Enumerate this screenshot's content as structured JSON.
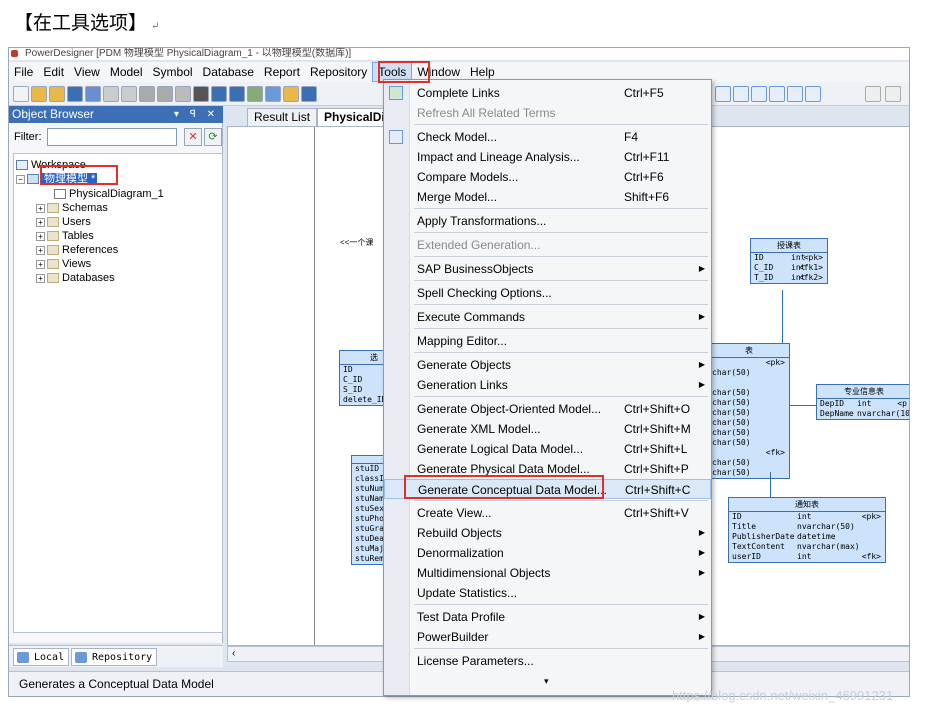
{
  "caption": "【在工具选项】",
  "caption_mark": "↵",
  "titlebar_text": "PowerDesigner [PDM 物理模型 PhysicalDiagram_1 - 以物理模型(数据库)]",
  "menubar": [
    "File",
    "Edit",
    "View",
    "Model",
    "Symbol",
    "Database",
    "Report",
    "Repository",
    "Tools",
    "Window",
    "Help"
  ],
  "active_menu": "Tools",
  "object_browser": {
    "title": "Object Browser",
    "controls": "▾ ꟼ ✕",
    "filter_label": "Filter:",
    "tree": {
      "workspace": "Workspace",
      "model": "物理模型 *",
      "diagram": "PhysicalDiagram_1",
      "folders": [
        "Schemas",
        "Users",
        "Tables",
        "References",
        "Views",
        "Databases"
      ]
    },
    "tabs": [
      "Local",
      "Repository"
    ]
  },
  "diagram_tabs": [
    "Result List",
    "PhysicalDia"
  ],
  "status": "Generates a Conceptual Data Model",
  "tools_menu": {
    "items": [
      {
        "label": "Complete Links",
        "shortcut": "Ctrl+F5",
        "icon": "links-icon"
      },
      {
        "label": "Refresh All Related Terms",
        "disabled": true
      },
      {
        "sep": true
      },
      {
        "label": "Check Model...",
        "shortcut": "F4",
        "icon": "check-model-icon"
      },
      {
        "label": "Impact and Lineage Analysis...",
        "shortcut": "Ctrl+F11"
      },
      {
        "label": "Compare Models...",
        "shortcut": "Ctrl+F6"
      },
      {
        "label": "Merge Model...",
        "shortcut": "Shift+F6"
      },
      {
        "sep": true
      },
      {
        "label": "Apply Transformations..."
      },
      {
        "sep": true
      },
      {
        "label": "Extended Generation...",
        "disabled": true
      },
      {
        "sep": true
      },
      {
        "label": "SAP BusinessObjects",
        "submenu": true
      },
      {
        "sep": true
      },
      {
        "label": "Spell Checking Options..."
      },
      {
        "sep": true
      },
      {
        "label": "Execute Commands",
        "submenu": true
      },
      {
        "sep": true
      },
      {
        "label": "Mapping Editor..."
      },
      {
        "sep": true
      },
      {
        "label": "Generate Objects",
        "submenu": true
      },
      {
        "label": "Generation Links",
        "submenu": true
      },
      {
        "sep": true
      },
      {
        "label": "Generate Object-Oriented Model...",
        "shortcut": "Ctrl+Shift+O"
      },
      {
        "label": "Generate XML Model...",
        "shortcut": "Ctrl+Shift+M"
      },
      {
        "label": "Generate Logical Data Model...",
        "shortcut": "Ctrl+Shift+L"
      },
      {
        "label": "Generate Physical Data Model...",
        "shortcut": "Ctrl+Shift+P"
      },
      {
        "label": "Generate Conceptual Data Model...",
        "shortcut": "Ctrl+Shift+C",
        "highlighted": true
      },
      {
        "sep": true
      },
      {
        "label": "Create View...",
        "shortcut": "Ctrl+Shift+V"
      },
      {
        "label": "Rebuild Objects",
        "submenu": true
      },
      {
        "label": "Denormalization",
        "submenu": true
      },
      {
        "label": "Multidimensional Objects",
        "submenu": true
      },
      {
        "label": "Update Statistics..."
      },
      {
        "sep": true
      },
      {
        "label": "Test Data Profile",
        "submenu": true
      },
      {
        "label": "PowerBuilder",
        "submenu": true
      },
      {
        "sep": true
      },
      {
        "label": "License Parameters..."
      }
    ],
    "more_arrow": "▾"
  },
  "diagram": {
    "relation_text": "<<一个课",
    "tables": [
      {
        "title": "授课表",
        "rows": [
          [
            "ID",
            "int",
            "<pk>"
          ],
          [
            "C_ID",
            "int",
            "<fk1>"
          ],
          [
            "T_ID",
            "int",
            "<fk2>"
          ]
        ]
      },
      {
        "title": "选",
        "rows": [
          [
            "ID",
            "",
            ""
          ],
          [
            "C_ID",
            "",
            ""
          ],
          [
            "S_ID",
            "",
            ""
          ],
          [
            "delete_ID",
            "",
            ""
          ]
        ]
      },
      {
        "title": "专业信息表",
        "rows": [
          [
            "DepID",
            "int",
            "<p"
          ],
          [
            "DepName",
            "nvarchar(100)",
            ""
          ]
        ]
      },
      {
        "title": "通知表",
        "rows": [
          [
            "ID",
            "int",
            "<pk>"
          ],
          [
            "Title",
            "nvarchar(50)",
            ""
          ],
          [
            "PublisherDate",
            "datetime",
            ""
          ],
          [
            "TextContent",
            "nvarchar(max)",
            ""
          ],
          [
            "userID",
            "int",
            "<fk>"
          ]
        ]
      },
      {
        "title": "",
        "rows": [
          [
            "stuID"
          ],
          [
            "classID"
          ],
          [
            "stuNumber"
          ],
          [
            "stuName"
          ],
          [
            "stuSex"
          ],
          [
            "stuPhone"
          ],
          [
            "stuGrade"
          ],
          [
            "stuDeapr"
          ],
          [
            "stuMajor"
          ],
          [
            "stuRemar"
          ]
        ]
      },
      {
        "title": "表",
        "rows": [
          [
            "",
            "<pk>"
          ],
          [
            "char(50)",
            ""
          ],
          [
            "",
            ""
          ],
          [
            "char(50)",
            ""
          ],
          [
            "char(50)",
            ""
          ],
          [
            "char(50)",
            ""
          ],
          [
            "char(50)",
            ""
          ],
          [
            "char(50)",
            ""
          ],
          [
            "char(50)",
            ""
          ],
          [
            "",
            "<fk>"
          ],
          [
            "char(50)",
            ""
          ],
          [
            "char(50)",
            ""
          ]
        ]
      }
    ]
  },
  "watermark": "https://blog.csdn.net/weixin_46991231"
}
